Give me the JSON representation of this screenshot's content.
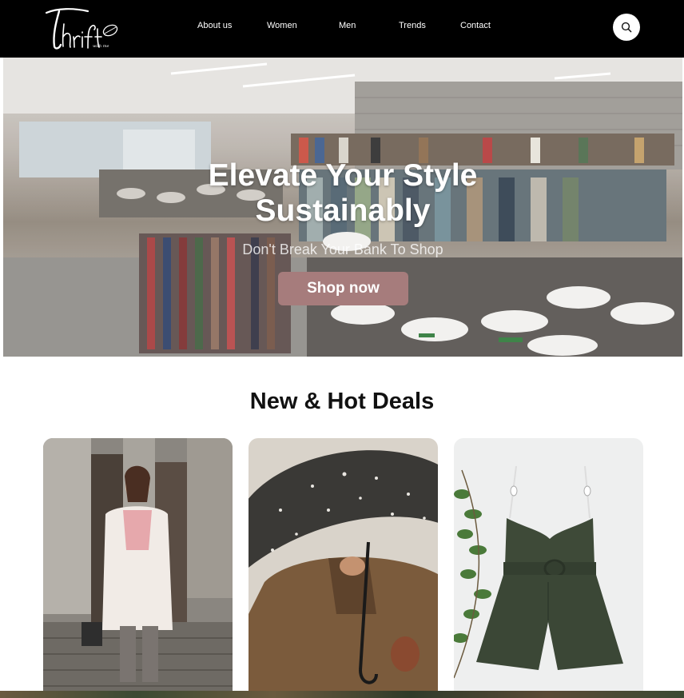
{
  "brand": {
    "logo_text": "Thrift",
    "logo_subtext": "with me"
  },
  "nav": {
    "items": [
      {
        "label": "About us"
      },
      {
        "label": "Women"
      },
      {
        "label": "Men"
      },
      {
        "label": "Trends"
      },
      {
        "label": "Contact"
      }
    ],
    "search_icon": "search-icon"
  },
  "hero": {
    "title": "Elevate Your Style\nSustainably",
    "subtitle": "Don't Break Your Bank To Shop",
    "cta_label": "Shop now",
    "cta_color": "#a67c7c"
  },
  "deals": {
    "title": "New & Hot Deals",
    "cards": [
      {
        "image": "woman-in-white-coat"
      },
      {
        "image": "man-with-umbrella-in-snow"
      },
      {
        "image": "olive-green-romper"
      }
    ]
  }
}
